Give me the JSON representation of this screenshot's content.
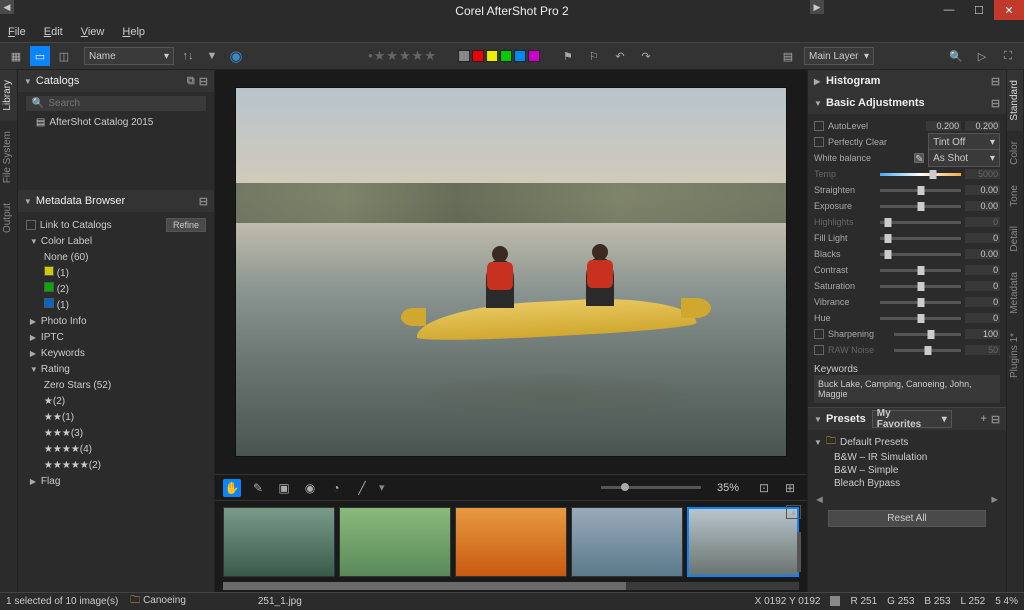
{
  "app": {
    "title": "Corel AfterShot Pro 2"
  },
  "menubar": [
    "File",
    "Edit",
    "View",
    "Help"
  ],
  "toolbar": {
    "sort_dropdown": "Name",
    "layer_dropdown": "Main Layer"
  },
  "color_swatches": [
    "#888",
    "#e00",
    "#ee0",
    "#0c0",
    "#08e",
    "#c0c"
  ],
  "left_tabs": [
    "Library",
    "File System",
    "Output"
  ],
  "catalogs": {
    "title": "Catalogs",
    "search_placeholder": "Search",
    "items": [
      "AfterShot Catalog 2015"
    ]
  },
  "metadata": {
    "title": "Metadata Browser",
    "link_label": "Link to Catalogs",
    "refine": "Refine",
    "color_label_title": "Color Label",
    "color_labels": [
      {
        "name": "None",
        "count": "(60)",
        "color": ""
      },
      {
        "name": "",
        "count": "(1)",
        "color": "#cc0"
      },
      {
        "name": "",
        "count": "(2)",
        "color": "#0a0"
      },
      {
        "name": "",
        "count": "(1)",
        "color": "#06c"
      }
    ],
    "sections": [
      "Photo Info",
      "IPTC",
      "Keywords"
    ],
    "rating_title": "Rating",
    "zero_stars": "Zero Stars (52)",
    "ratings": [
      {
        "stars": "★",
        "count": "(2)"
      },
      {
        "stars": "★★",
        "count": "(1)"
      },
      {
        "stars": "★★★",
        "count": "(3)"
      },
      {
        "stars": "★★★★",
        "count": "(4)"
      },
      {
        "stars": "★★★★★",
        "count": "(2)"
      }
    ],
    "flag": "Flag"
  },
  "viewer": {
    "zoom": "35%",
    "filename": "251_1.jpg"
  },
  "histogram_title": "Histogram",
  "basic_adj": {
    "title": "Basic Adjustments",
    "autolevel": {
      "label": "AutoLevel",
      "v1": "0.200",
      "v2": "0.200"
    },
    "perfectly_clear": {
      "label": "Perfectly Clear",
      "dropdown": "Tint Off"
    },
    "white_balance": {
      "label": "White balance",
      "dropdown": "As Shot"
    },
    "sliders": [
      {
        "label": "Temp",
        "val": "5000",
        "dim": true,
        "wb": true,
        "pos": "65%"
      },
      {
        "label": "Straighten",
        "val": "0.00",
        "pos": "50%"
      },
      {
        "label": "Exposure",
        "val": "0.00",
        "pos": "50%"
      },
      {
        "label": "Highlights",
        "val": "0",
        "dim": true,
        "pos": "10%"
      },
      {
        "label": "Fill Light",
        "val": "0",
        "pos": "10%"
      },
      {
        "label": "Blacks",
        "val": "0.00",
        "pos": "10%"
      },
      {
        "label": "Contrast",
        "val": "0",
        "pos": "50%"
      },
      {
        "label": "Saturation",
        "val": "0",
        "pos": "50%"
      },
      {
        "label": "Vibrance",
        "val": "0",
        "pos": "50%"
      },
      {
        "label": "Hue",
        "val": "0",
        "pos": "50%"
      },
      {
        "label": "Sharpening",
        "val": "100",
        "chk": true,
        "pos": "55%"
      },
      {
        "label": "RAW Noise",
        "val": "50",
        "dim": true,
        "chk": true,
        "pos": "50%"
      }
    ],
    "keywords_label": "Keywords",
    "keywords": "Buck Lake, Camping, Canoeing, John, Maggie"
  },
  "presets": {
    "title": "Presets",
    "dropdown": "My Favorites",
    "folder": "Default Presets",
    "items": [
      "B&W – IR Simulation",
      "B&W – Simple",
      "Bleach Bypass"
    ],
    "reset": "Reset All"
  },
  "right_tabs": [
    "Standard",
    "Color",
    "Tone",
    "Detail",
    "Metadata",
    "Plugins 1*"
  ],
  "status": {
    "selection": "1 selected of 10 image(s)",
    "folder": "Canoeing",
    "coords": "X 0192   Y 0192",
    "r": "R  251",
    "g": "G  253",
    "b": "B  253",
    "l": "L  252",
    "sat": "5  4%"
  }
}
